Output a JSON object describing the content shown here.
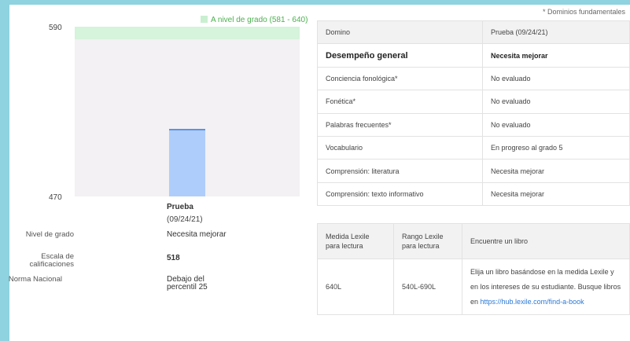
{
  "footnote": "* Dominios fundamentales",
  "chart_data": {
    "type": "bar",
    "ylim": [
      470,
      590
    ],
    "ytick_labels": [
      "590",
      "470"
    ],
    "band": {
      "label": "A nivel de grado (581 - 640)",
      "from": 581,
      "to": 640,
      "color": "#d6f3dc"
    },
    "categories": [
      "Prueba"
    ],
    "category_dates": [
      "(09/24/21)"
    ],
    "values": [
      518
    ],
    "bar_color": "#afcdfb",
    "grid": false
  },
  "summary": {
    "grade_level": {
      "label": "Nivel de grado",
      "value": "Necesita mejorar"
    },
    "scale": {
      "label": "Escala de calificaciones",
      "value": "518"
    },
    "norm": {
      "label": "Norma Nacional",
      "value": "Debajo del percentil 25"
    }
  },
  "domains_table": {
    "headers": [
      "Domino",
      "Prueba (09/24/21)"
    ],
    "overall": [
      "Desempeño general",
      "Necesita mejorar"
    ],
    "rows": [
      [
        "Conciencia fonológica*",
        "No evaluado"
      ],
      [
        "Fonética*",
        "No evaluado"
      ],
      [
        "Palabras frecuentes*",
        "No evaluado"
      ],
      [
        "Vocabulario",
        "En progreso al grado 5"
      ],
      [
        "Comprensión: literatura",
        "Necesita mejorar"
      ],
      [
        "Comprensión: texto informativo",
        "Necesita mejorar"
      ]
    ]
  },
  "lexile_table": {
    "headers": [
      "Medida Lexile para lectura",
      "Rango Lexile para lectura",
      "Encuentre un libro"
    ],
    "measure": "640L",
    "range": "540L-690L",
    "find_text": "Elija un libro basándose en la medida Lexile y en los intereses de su estudiante. Busque libros en",
    "find_link": "https://hub.lexile.com/find-a-book"
  }
}
